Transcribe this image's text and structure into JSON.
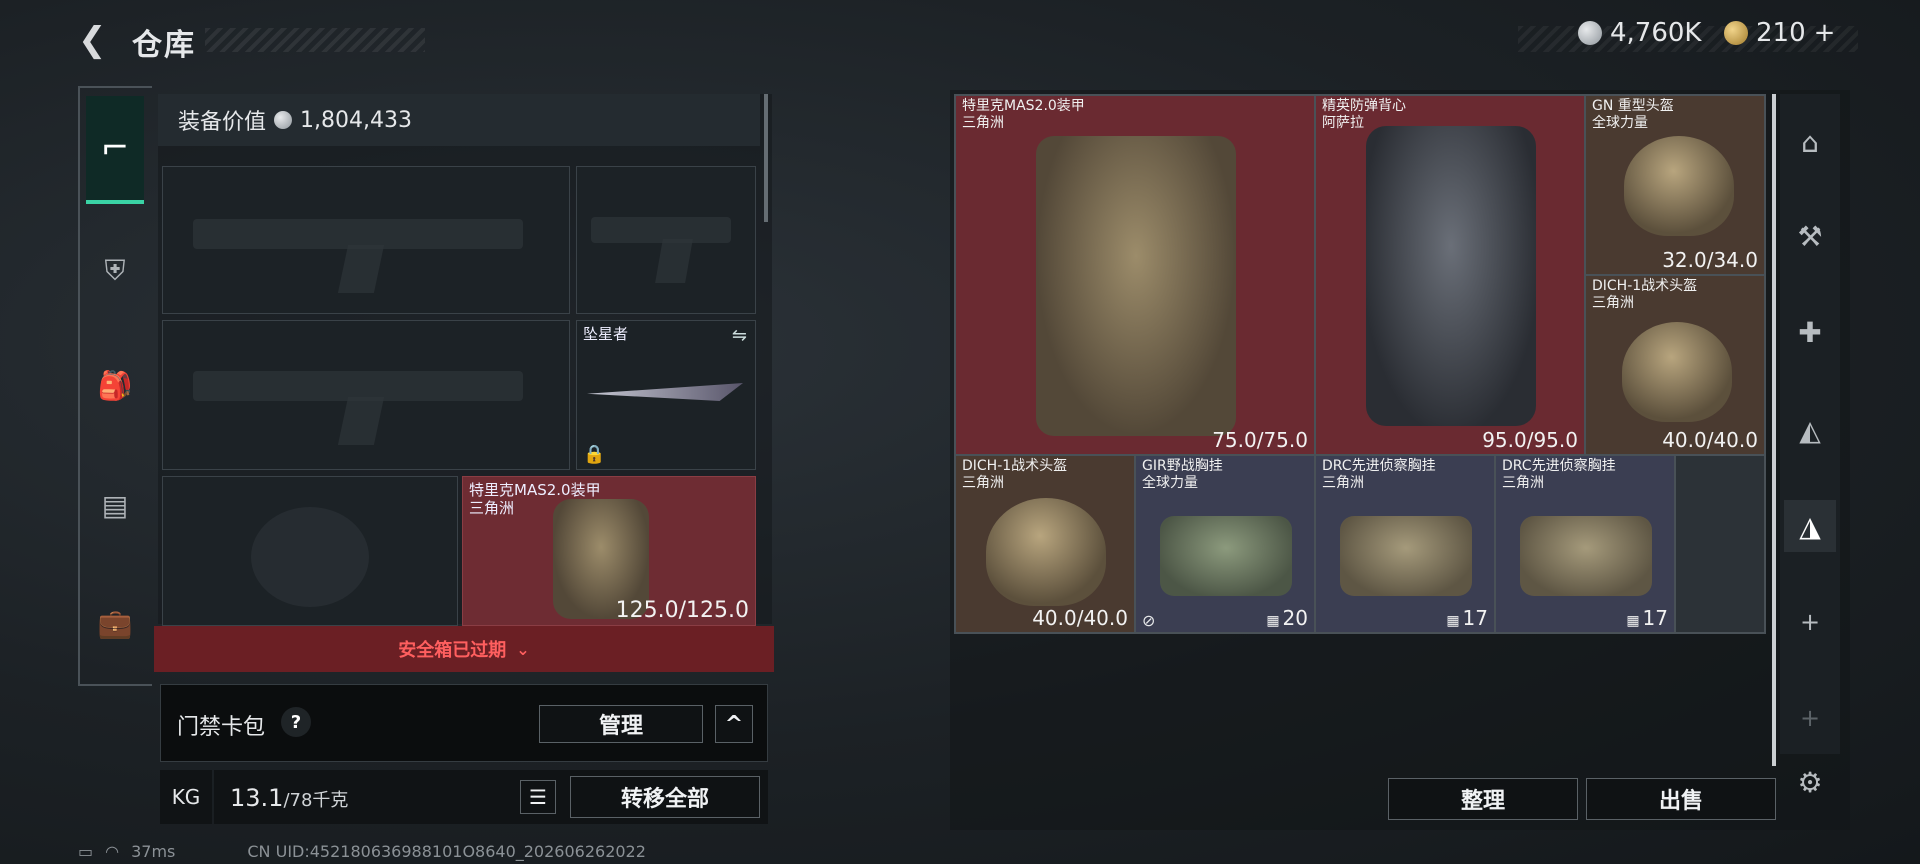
{
  "header": {
    "title": "仓库",
    "currency": [
      {
        "icon": "silver-coin-icon",
        "value": "4,760K"
      },
      {
        "icon": "gold-coin-icon",
        "value": "210"
      }
    ],
    "add_symbol": "+"
  },
  "left_tabs": [
    {
      "icon": "pistol-icon",
      "active": true
    },
    {
      "icon": "armor-icon",
      "active": false
    },
    {
      "icon": "backpack-icon",
      "active": false
    },
    {
      "icon": "chest-rig-icon",
      "active": false
    },
    {
      "icon": "toolbox-icon",
      "active": false
    }
  ],
  "loadout": {
    "value_label": "装备价值",
    "value": "1,804,433",
    "melee_label": "坠星者",
    "armor_slot": {
      "name": "特里克MAS2.0装甲",
      "source": "三角洲",
      "durability": "125.0/125.0"
    }
  },
  "safebox": {
    "text": "安全箱已过期"
  },
  "keycard": {
    "label": "门禁卡包",
    "help": "?",
    "manage": "管理",
    "collapse": "^"
  },
  "weight": {
    "icon_text": "KG",
    "current": "13.1",
    "max": "/78千克"
  },
  "transfer_all": "转移全部",
  "status_bar": {
    "ping": "37ms",
    "uid": "CN UID:452180636988101O8640_202606262022"
  },
  "inventory": [
    {
      "name": "特里克MAS2.0装甲",
      "source": "三角洲",
      "value": "75.0/75.0",
      "color": "#6a2a31"
    },
    {
      "name": "精英防弹背心",
      "source": "阿萨拉",
      "value": "95.0/95.0",
      "color": "#6a2a31"
    },
    {
      "name": "GN 重型头盔",
      "source": "全球力量",
      "value": "32.0/34.0",
      "color": "#4a3a30"
    },
    {
      "name": "DICH-1战术头盔",
      "source": "三角洲",
      "value": "40.0/40.0",
      "color": "#4a3a30"
    },
    {
      "name": "DICH-1战术头盔",
      "source": "三角洲",
      "value": "40.0/40.0",
      "color": "#4a3a30"
    },
    {
      "name": "GIR野战胸挂",
      "source": "全球力量",
      "value": "20",
      "color": "#3b3e52"
    },
    {
      "name": "DRC先进侦察胸挂",
      "source": "三角洲",
      "value": "17",
      "color": "#3b3e52"
    },
    {
      "name": "DRC先进侦察胸挂",
      "source": "三角洲",
      "value": "17",
      "color": "#3b3e52"
    }
  ],
  "actions": {
    "sort": "整理",
    "sell": "出售"
  },
  "tool_rail": [
    "helmet-filter-icon",
    "weapon-filter-icon",
    "medkit-filter-icon",
    "armor-filter-icon",
    "selected-filter-icon",
    "add-icon",
    "add-icon",
    "settings-icon"
  ]
}
